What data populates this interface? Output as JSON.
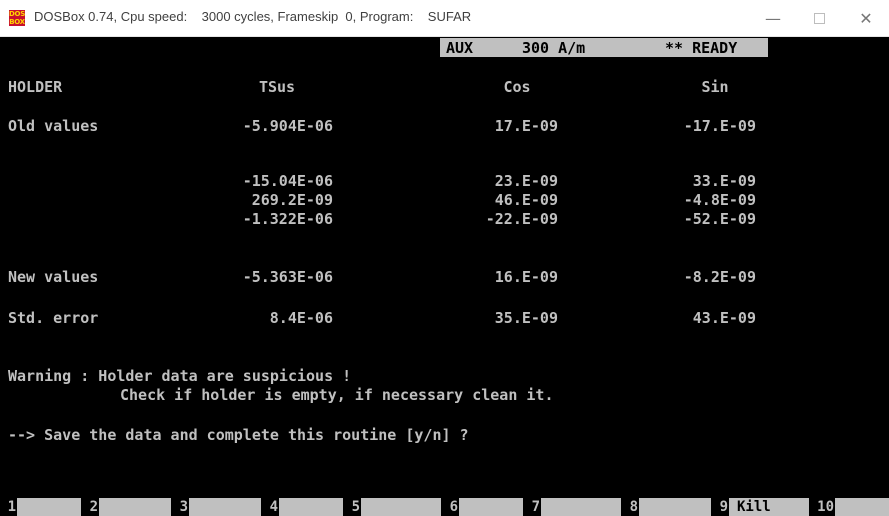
{
  "window": {
    "icon_label": "DOS BOX",
    "title": "DOSBox 0.74, Cpu speed:    3000 cycles, Frameskip  0, Program:    SUFAR",
    "minimize_glyph": "—",
    "close_glyph": "✕"
  },
  "status": {
    "mode": "AUX",
    "field": "300 A/m",
    "state": "** READY"
  },
  "table": {
    "headers": [
      "HOLDER",
      "TSus",
      "Cos",
      "Sin"
    ],
    "old_values": {
      "label": "Old values",
      "tsus": "-5.904E-06",
      "cos": "17.E-09",
      "sin": "-17.E-09"
    },
    "measurements": [
      {
        "tsus": "-15.04E-06",
        "cos": "23.E-09",
        "sin": "33.E-09"
      },
      {
        "tsus": "269.2E-09",
        "cos": "46.E-09",
        "sin": "-4.8E-09"
      },
      {
        "tsus": "-1.322E-06",
        "cos": "-22.E-09",
        "sin": "-52.E-09"
      }
    ],
    "new_values": {
      "label": "New values",
      "tsus": "-5.363E-06",
      "cos": "16.E-09",
      "sin": "-8.2E-09"
    },
    "std_error": {
      "label": "Std. error",
      "tsus": "8.4E-06",
      "cos": "35.E-09",
      "sin": "43.E-09"
    }
  },
  "messages": {
    "warning": "Warning : Holder data are suspicious !",
    "warning_detail": "Check if holder is empty, if necessary clean it.",
    "prompt": "--> Save the data and complete this routine [y/n] ?"
  },
  "function_keys": [
    {
      "num": "1",
      "label": ""
    },
    {
      "num": "2",
      "label": ""
    },
    {
      "num": "3",
      "label": ""
    },
    {
      "num": "4",
      "label": ""
    },
    {
      "num": "5",
      "label": ""
    },
    {
      "num": "6",
      "label": ""
    },
    {
      "num": "7",
      "label": ""
    },
    {
      "num": "8",
      "label": ""
    },
    {
      "num": "9",
      "label": "Kill"
    },
    {
      "num": "10",
      "label": ""
    }
  ],
  "colors": {
    "screen_bg": "#000000",
    "screen_text": "#c0c0c0",
    "highlight_bg": "#c0c0c0",
    "highlight_text": "#000000"
  }
}
